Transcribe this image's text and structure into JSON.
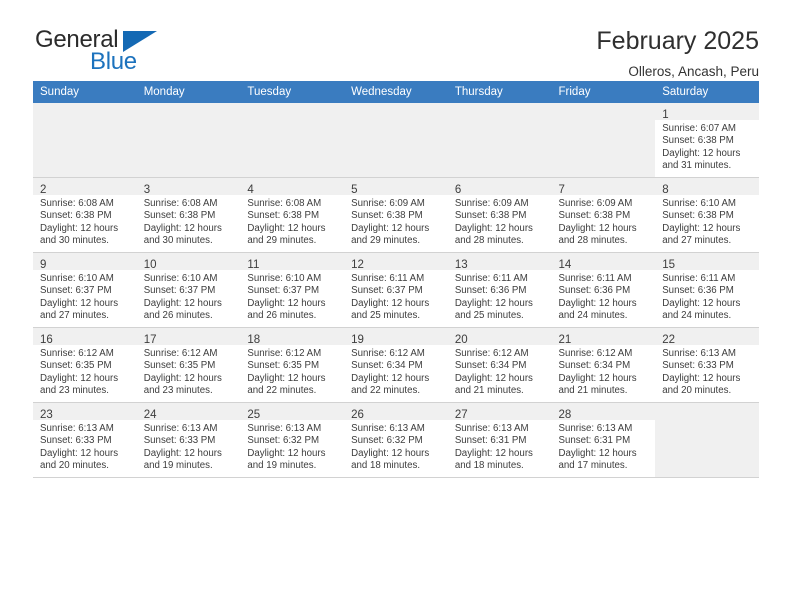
{
  "brand": {
    "name_part1": "General",
    "name_part2": "Blue",
    "accent_color": "#1469b4"
  },
  "header": {
    "title": "February 2025",
    "location": "Olleros, Ancash, Peru"
  },
  "calendar": {
    "header_bg": "#3a7cc0",
    "weekday_headers": [
      "Sunday",
      "Monday",
      "Tuesday",
      "Wednesday",
      "Thursday",
      "Friday",
      "Saturday"
    ],
    "weeks": [
      [
        {
          "day": "",
          "sunrise": "",
          "sunset": "",
          "daylight_line1": "",
          "daylight_line2": ""
        },
        {
          "day": "",
          "sunrise": "",
          "sunset": "",
          "daylight_line1": "",
          "daylight_line2": ""
        },
        {
          "day": "",
          "sunrise": "",
          "sunset": "",
          "daylight_line1": "",
          "daylight_line2": ""
        },
        {
          "day": "",
          "sunrise": "",
          "sunset": "",
          "daylight_line1": "",
          "daylight_line2": ""
        },
        {
          "day": "",
          "sunrise": "",
          "sunset": "",
          "daylight_line1": "",
          "daylight_line2": ""
        },
        {
          "day": "",
          "sunrise": "",
          "sunset": "",
          "daylight_line1": "",
          "daylight_line2": ""
        },
        {
          "day": "1",
          "sunrise": "Sunrise: 6:07 AM",
          "sunset": "Sunset: 6:38 PM",
          "daylight_line1": "Daylight: 12 hours",
          "daylight_line2": "and 31 minutes."
        }
      ],
      [
        {
          "day": "2",
          "sunrise": "Sunrise: 6:08 AM",
          "sunset": "Sunset: 6:38 PM",
          "daylight_line1": "Daylight: 12 hours",
          "daylight_line2": "and 30 minutes."
        },
        {
          "day": "3",
          "sunrise": "Sunrise: 6:08 AM",
          "sunset": "Sunset: 6:38 PM",
          "daylight_line1": "Daylight: 12 hours",
          "daylight_line2": "and 30 minutes."
        },
        {
          "day": "4",
          "sunrise": "Sunrise: 6:08 AM",
          "sunset": "Sunset: 6:38 PM",
          "daylight_line1": "Daylight: 12 hours",
          "daylight_line2": "and 29 minutes."
        },
        {
          "day": "5",
          "sunrise": "Sunrise: 6:09 AM",
          "sunset": "Sunset: 6:38 PM",
          "daylight_line1": "Daylight: 12 hours",
          "daylight_line2": "and 29 minutes."
        },
        {
          "day": "6",
          "sunrise": "Sunrise: 6:09 AM",
          "sunset": "Sunset: 6:38 PM",
          "daylight_line1": "Daylight: 12 hours",
          "daylight_line2": "and 28 minutes."
        },
        {
          "day": "7",
          "sunrise": "Sunrise: 6:09 AM",
          "sunset": "Sunset: 6:38 PM",
          "daylight_line1": "Daylight: 12 hours",
          "daylight_line2": "and 28 minutes."
        },
        {
          "day": "8",
          "sunrise": "Sunrise: 6:10 AM",
          "sunset": "Sunset: 6:38 PM",
          "daylight_line1": "Daylight: 12 hours",
          "daylight_line2": "and 27 minutes."
        }
      ],
      [
        {
          "day": "9",
          "sunrise": "Sunrise: 6:10 AM",
          "sunset": "Sunset: 6:37 PM",
          "daylight_line1": "Daylight: 12 hours",
          "daylight_line2": "and 27 minutes."
        },
        {
          "day": "10",
          "sunrise": "Sunrise: 6:10 AM",
          "sunset": "Sunset: 6:37 PM",
          "daylight_line1": "Daylight: 12 hours",
          "daylight_line2": "and 26 minutes."
        },
        {
          "day": "11",
          "sunrise": "Sunrise: 6:10 AM",
          "sunset": "Sunset: 6:37 PM",
          "daylight_line1": "Daylight: 12 hours",
          "daylight_line2": "and 26 minutes."
        },
        {
          "day": "12",
          "sunrise": "Sunrise: 6:11 AM",
          "sunset": "Sunset: 6:37 PM",
          "daylight_line1": "Daylight: 12 hours",
          "daylight_line2": "and 25 minutes."
        },
        {
          "day": "13",
          "sunrise": "Sunrise: 6:11 AM",
          "sunset": "Sunset: 6:36 PM",
          "daylight_line1": "Daylight: 12 hours",
          "daylight_line2": "and 25 minutes."
        },
        {
          "day": "14",
          "sunrise": "Sunrise: 6:11 AM",
          "sunset": "Sunset: 6:36 PM",
          "daylight_line1": "Daylight: 12 hours",
          "daylight_line2": "and 24 minutes."
        },
        {
          "day": "15",
          "sunrise": "Sunrise: 6:11 AM",
          "sunset": "Sunset: 6:36 PM",
          "daylight_line1": "Daylight: 12 hours",
          "daylight_line2": "and 24 minutes."
        }
      ],
      [
        {
          "day": "16",
          "sunrise": "Sunrise: 6:12 AM",
          "sunset": "Sunset: 6:35 PM",
          "daylight_line1": "Daylight: 12 hours",
          "daylight_line2": "and 23 minutes."
        },
        {
          "day": "17",
          "sunrise": "Sunrise: 6:12 AM",
          "sunset": "Sunset: 6:35 PM",
          "daylight_line1": "Daylight: 12 hours",
          "daylight_line2": "and 23 minutes."
        },
        {
          "day": "18",
          "sunrise": "Sunrise: 6:12 AM",
          "sunset": "Sunset: 6:35 PM",
          "daylight_line1": "Daylight: 12 hours",
          "daylight_line2": "and 22 minutes."
        },
        {
          "day": "19",
          "sunrise": "Sunrise: 6:12 AM",
          "sunset": "Sunset: 6:34 PM",
          "daylight_line1": "Daylight: 12 hours",
          "daylight_line2": "and 22 minutes."
        },
        {
          "day": "20",
          "sunrise": "Sunrise: 6:12 AM",
          "sunset": "Sunset: 6:34 PM",
          "daylight_line1": "Daylight: 12 hours",
          "daylight_line2": "and 21 minutes."
        },
        {
          "day": "21",
          "sunrise": "Sunrise: 6:12 AM",
          "sunset": "Sunset: 6:34 PM",
          "daylight_line1": "Daylight: 12 hours",
          "daylight_line2": "and 21 minutes."
        },
        {
          "day": "22",
          "sunrise": "Sunrise: 6:13 AM",
          "sunset": "Sunset: 6:33 PM",
          "daylight_line1": "Daylight: 12 hours",
          "daylight_line2": "and 20 minutes."
        }
      ],
      [
        {
          "day": "23",
          "sunrise": "Sunrise: 6:13 AM",
          "sunset": "Sunset: 6:33 PM",
          "daylight_line1": "Daylight: 12 hours",
          "daylight_line2": "and 20 minutes."
        },
        {
          "day": "24",
          "sunrise": "Sunrise: 6:13 AM",
          "sunset": "Sunset: 6:33 PM",
          "daylight_line1": "Daylight: 12 hours",
          "daylight_line2": "and 19 minutes."
        },
        {
          "day": "25",
          "sunrise": "Sunrise: 6:13 AM",
          "sunset": "Sunset: 6:32 PM",
          "daylight_line1": "Daylight: 12 hours",
          "daylight_line2": "and 19 minutes."
        },
        {
          "day": "26",
          "sunrise": "Sunrise: 6:13 AM",
          "sunset": "Sunset: 6:32 PM",
          "daylight_line1": "Daylight: 12 hours",
          "daylight_line2": "and 18 minutes."
        },
        {
          "day": "27",
          "sunrise": "Sunrise: 6:13 AM",
          "sunset": "Sunset: 6:31 PM",
          "daylight_line1": "Daylight: 12 hours",
          "daylight_line2": "and 18 minutes."
        },
        {
          "day": "28",
          "sunrise": "Sunrise: 6:13 AM",
          "sunset": "Sunset: 6:31 PM",
          "daylight_line1": "Daylight: 12 hours",
          "daylight_line2": "and 17 minutes."
        },
        {
          "day": "",
          "sunrise": "",
          "sunset": "",
          "daylight_line1": "",
          "daylight_line2": ""
        }
      ]
    ]
  }
}
